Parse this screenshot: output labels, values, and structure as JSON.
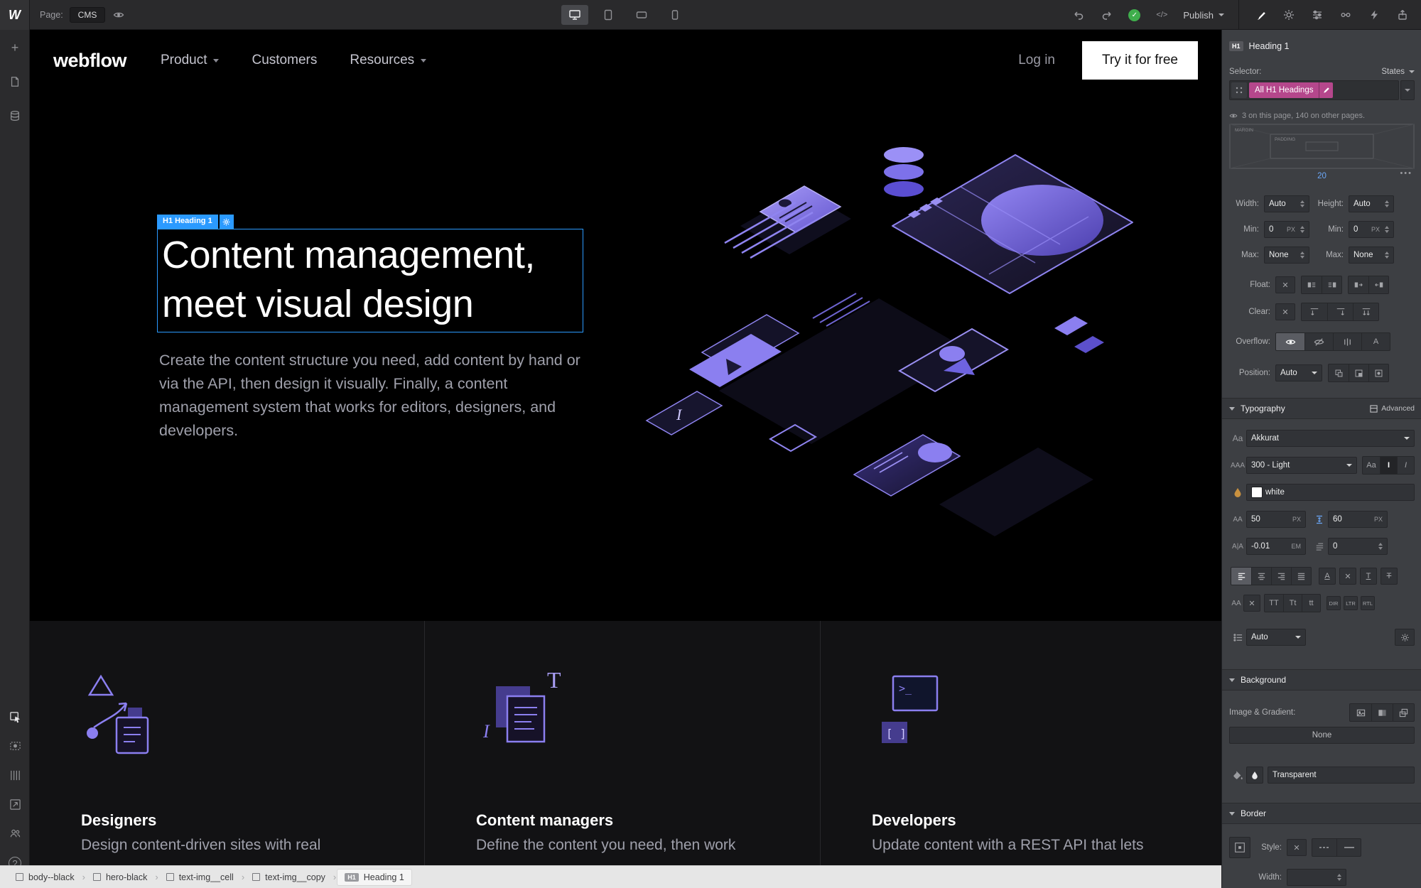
{
  "topbar": {
    "logo": "W",
    "page_label": "Page:",
    "page_value": "CMS",
    "publish_label": "Publish"
  },
  "site": {
    "brand": "webflow",
    "nav": [
      {
        "label": "Product"
      },
      {
        "label": "Customers"
      },
      {
        "label": "Resources"
      }
    ],
    "login": "Log in",
    "cta": "Try it for free",
    "selection_tag": "H1 Heading 1",
    "heading_line1": "Content management,",
    "heading_line2": "meet visual design",
    "paragraph": "Create the content structure you need, add content by hand or via the API, then design it visually. Finally, a content management system that works for editors, designers, and developers.",
    "features": [
      {
        "title": "Designers",
        "text": "Design content-driven sites with real"
      },
      {
        "title": "Content managers",
        "text": "Define the content you need, then work"
      },
      {
        "title": "Developers",
        "text": "Update content with a REST API that lets"
      }
    ]
  },
  "panel": {
    "tag": "H1",
    "element_name": "Heading 1",
    "selector_label": "Selector:",
    "states_label": "States",
    "selector_pill": "All H1 Headings",
    "usage_note": "3 on this page, 140 on other pages.",
    "margin_label": "MARGIN",
    "padding_label": "PADDING",
    "spacing_value": "20",
    "width_label": "Width:",
    "height_label": "Height:",
    "auto_value": "Auto",
    "min_label": "Min:",
    "min_value": "0",
    "max_label": "Max:",
    "max_value": "None",
    "unit_px": "PX",
    "unit_em": "EM",
    "float_label": "Float:",
    "clear_label": "Clear:",
    "overflow_label": "Overflow:",
    "position_label": "Position:",
    "position_value": "Auto",
    "typography_section": "Typography",
    "advanced_label": "Advanced",
    "font_value": "Akkurat",
    "weight_value": "300 - Light",
    "color_value": "white",
    "font_size_value": "50",
    "line_height_value": "60",
    "letter_spacing_value": "-0.01",
    "indent_value": "0",
    "tt_upper": "TT",
    "tt_cap": "Tt",
    "tt_lower": "tt",
    "dir_label": "DIR",
    "ltr_label": "LTR",
    "rtl_label": "RTL",
    "list_value": "Auto",
    "background_section": "Background",
    "image_gradient_label": "Image & Gradient:",
    "image_value": "None",
    "bg_color_value": "Transparent",
    "border_section": "Border",
    "style_label": "Style:",
    "border_width_label": "Width:"
  },
  "breadcrumb": {
    "items": [
      {
        "label": "body--black"
      },
      {
        "label": "hero-black"
      },
      {
        "label": "text-img__cell"
      },
      {
        "label": "text-img__copy"
      }
    ],
    "current_tag": "H1",
    "current_label": "Heading 1"
  },
  "colors": {
    "accent_blue": "#2b9aff",
    "selector_pink": "#b5478c",
    "illustration_purple": "#8b7ff0",
    "publish_green": "#3fae4c"
  }
}
